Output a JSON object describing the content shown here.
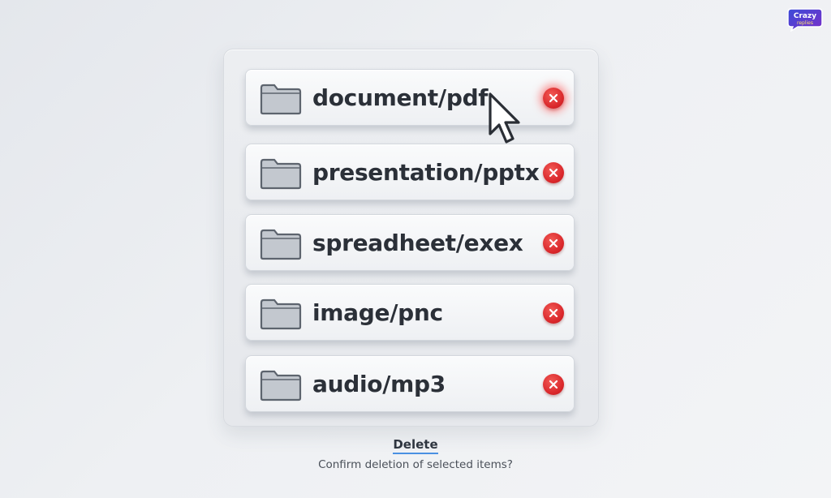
{
  "brand": {
    "line1": "Crazy",
    "line2": "replies"
  },
  "items": [
    {
      "label": "document/pdf",
      "remove_icon": "close-icon"
    },
    {
      "label": "presentation/pptx",
      "remove_icon": "close-icon"
    },
    {
      "label": "spreadheet/exex",
      "remove_icon": "close-icon"
    },
    {
      "label": "image/pnc",
      "remove_icon": "close-icon"
    },
    {
      "label": "audio/mp3",
      "remove_icon": "close-icon"
    }
  ],
  "footer": {
    "delete_label": "Delete",
    "confirm_text": "Confirm deletion of selected items?"
  },
  "colors": {
    "remove": "#d9262a",
    "accent_underline": "#4a90e2",
    "text": "#2b3038"
  }
}
